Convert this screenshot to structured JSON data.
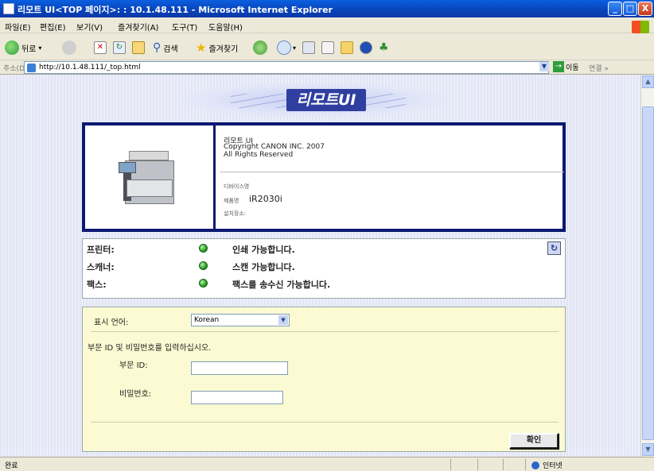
{
  "window": {
    "title": "리모트 UI<TOP 페이지>: : 10.1.48.111 - Microsoft Internet Explorer",
    "minimize": "_",
    "maximize": "□",
    "close": "X"
  },
  "menubar": {
    "items": [
      "파일(E)",
      "편집(E)",
      "보기(V)",
      "즐겨찾기(A)",
      "도구(T)",
      "도움말(H)"
    ]
  },
  "toolbar": {
    "back_label": "뒤로",
    "search_label": "검색",
    "favorites_label": "즐겨찾기"
  },
  "addressbar": {
    "label": "주소(D)",
    "url": "http://10.1.48.111/_top.html",
    "go_label": "이동",
    "links_label": "연결 »"
  },
  "banner": {
    "title": "리모트UI"
  },
  "device": {
    "product": "리모트 UI",
    "copyright": "Copyright CANON INC. 2007",
    "rights": "All Rights Reserved",
    "device_name_label": "디바이스명",
    "model_label": "제품명",
    "model_value": "iR2030i",
    "location_label": "설치장소:"
  },
  "status": {
    "rows": [
      {
        "label": "프린터:",
        "text": "인쇄 가능합니다."
      },
      {
        "label": "스캐너:",
        "text": "스캔 가능합니다."
      },
      {
        "label": "팩스:",
        "text": "팩스를 송수신 가능합니다."
      }
    ],
    "refresh_icon": "refresh-icon"
  },
  "login": {
    "language_label": "표시 언어:",
    "language_value": "Korean",
    "instruction": "부문 ID 및 비밀번호를 입력하십시오.",
    "dept_id_label": "부문 ID:",
    "dept_id_value": "",
    "password_label": "비밀번호:",
    "password_value": "",
    "ok_label": "확인"
  },
  "statusbar": {
    "done": "완료",
    "zone": "인터넷"
  }
}
